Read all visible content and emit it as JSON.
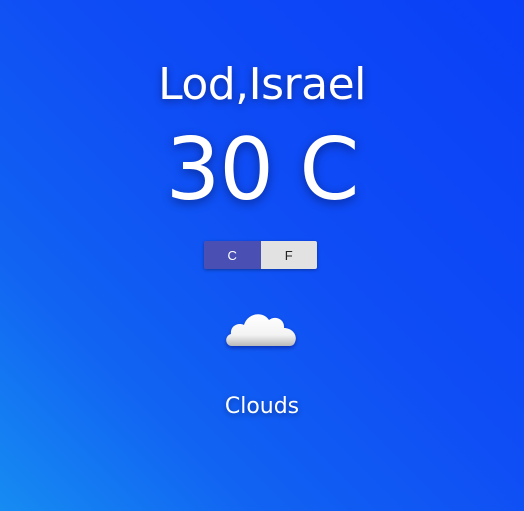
{
  "location": "Lod,Israel",
  "temperature": "30 C",
  "units": {
    "celsius_label": "C",
    "fahrenheit_label": "F",
    "active": "C"
  },
  "weather": {
    "icon": "cloud-icon",
    "condition": "Clouds"
  },
  "colors": {
    "background_top": "#0a3ff7",
    "background_bottom": "#168cf2",
    "toggle_active": "#4a4fb3",
    "toggle_inactive": "#e2e2e2"
  }
}
